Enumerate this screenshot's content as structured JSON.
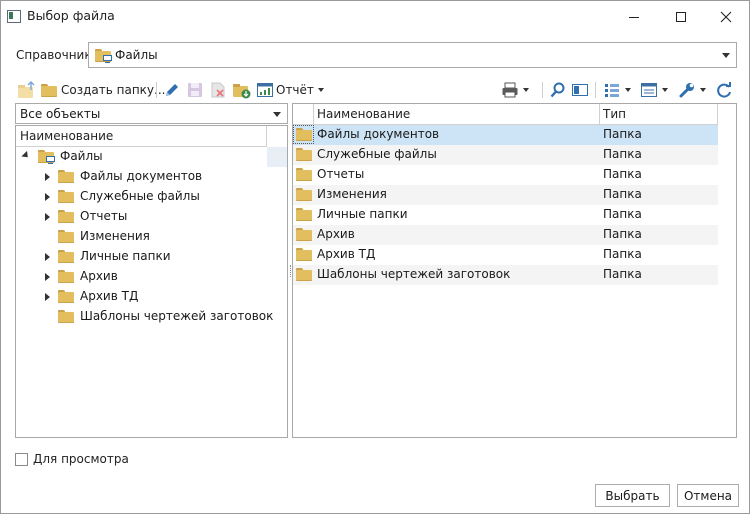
{
  "window": {
    "title": "Выбор файла"
  },
  "reference": {
    "label": "Справочник",
    "value": "Файлы"
  },
  "toolbar": {
    "create_folder_label": "Создать папку...",
    "report_label": "Отчёт"
  },
  "filter": {
    "value": "Все объекты"
  },
  "tree": {
    "column_header": "Наименование",
    "root": "Файлы",
    "items": [
      {
        "label": "Файлы документов",
        "expandable": true
      },
      {
        "label": "Служебные файлы",
        "expandable": true
      },
      {
        "label": "Отчеты",
        "expandable": true
      },
      {
        "label": "Изменения",
        "expandable": false
      },
      {
        "label": "Личные папки",
        "expandable": true
      },
      {
        "label": "Архив",
        "expandable": true
      },
      {
        "label": "Архив ТД",
        "expandable": true
      },
      {
        "label": "Шаблоны чертежей заготовок",
        "expandable": false
      }
    ]
  },
  "list": {
    "columns": {
      "name": "Наименование",
      "type": "Тип"
    },
    "rows": [
      {
        "name": "Файлы документов",
        "type": "Папка"
      },
      {
        "name": "Служебные файлы",
        "type": "Папка"
      },
      {
        "name": "Отчеты",
        "type": "Папка"
      },
      {
        "name": "Изменения",
        "type": "Папка"
      },
      {
        "name": "Личные папки",
        "type": "Папка"
      },
      {
        "name": "Архив",
        "type": "Папка"
      },
      {
        "name": "Архив ТД",
        "type": "Папка"
      },
      {
        "name": "Шаблоны чертежей заготовок",
        "type": "Папка"
      }
    ]
  },
  "preview_checkbox": {
    "label": "Для просмотра"
  },
  "buttons": {
    "select": "Выбрать",
    "cancel": "Отмена"
  },
  "icons": {
    "app": "app-window-icon",
    "minimize": "minimize-icon",
    "maximize": "maximize-icon",
    "close": "close-icon",
    "folder": "folder-icon",
    "computer": "computer-icon",
    "pencil": "pencil-icon",
    "save": "save-icon",
    "delete": "delete-icon",
    "download_folder": "folder-download-icon",
    "report": "report-icon",
    "print": "printer-icon",
    "search": "search-icon",
    "preview": "preview-icon",
    "columns": "columns-icon",
    "view": "view-icon",
    "settings": "wrench-icon",
    "refresh": "refresh-icon"
  },
  "colors": {
    "accent": "#1e6fc0",
    "selection": "#cde4f7",
    "folder": "#e3be5f"
  }
}
